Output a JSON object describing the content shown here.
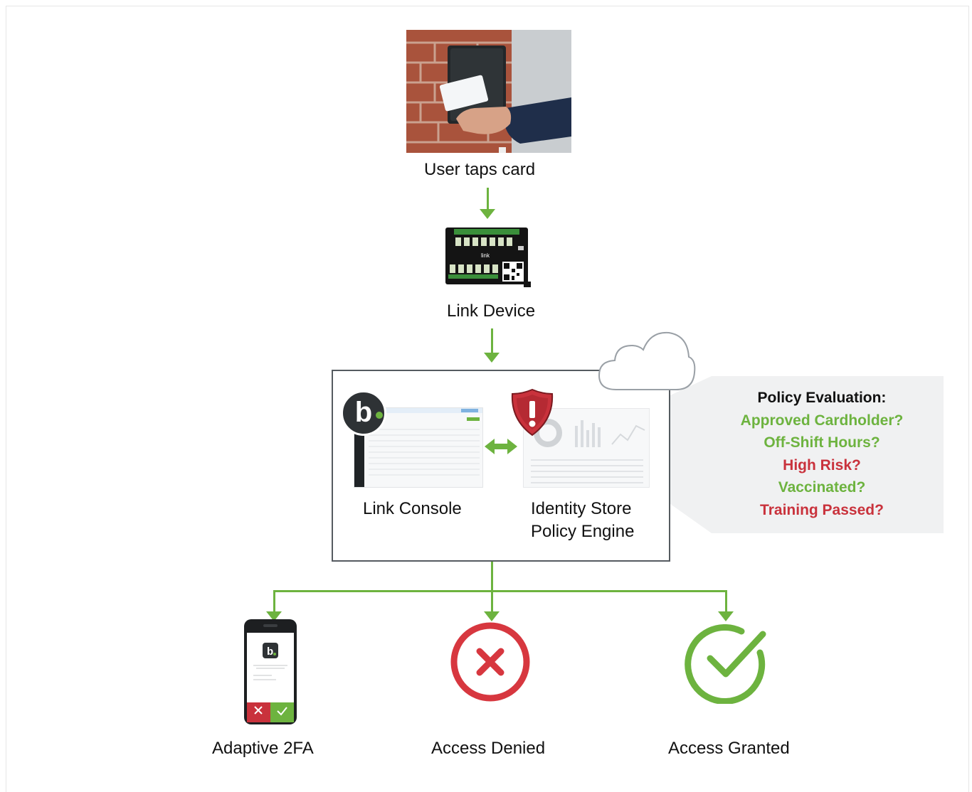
{
  "steps": {
    "tap_label": "User taps card",
    "device_label": "Link Device",
    "console_label": "Link Console",
    "identity_label_line1": "Identity Store",
    "identity_label_line2": "Policy Engine"
  },
  "policy": {
    "title": "Policy Evaluation:",
    "items": [
      {
        "label": "Approved Cardholder?",
        "color": "#6db33f"
      },
      {
        "label": "Off-Shift Hours?",
        "color": "#6db33f"
      },
      {
        "label": "High Risk?",
        "color": "#c9323c"
      },
      {
        "label": "Vaccinated?",
        "color": "#6db33f"
      },
      {
        "label": "Training Passed?",
        "color": "#c9323c"
      }
    ]
  },
  "outcomes": {
    "twofa_label": "Adaptive 2FA",
    "denied_label": "Access Denied",
    "granted_label": "Access Granted"
  },
  "device": {
    "brand_text": "link"
  },
  "console": {
    "logo_letter": "b"
  },
  "colors": {
    "accent_green": "#6db33f",
    "alert_red": "#c9323c"
  },
  "icons": {
    "tap": "card-reader-photo",
    "device": "link-device-board",
    "cloud": "cloud-icon",
    "shield": "shield-alert-icon",
    "denied": "x-circle-icon",
    "granted": "check-circle-icon",
    "phone": "phone-2fa-icon"
  }
}
